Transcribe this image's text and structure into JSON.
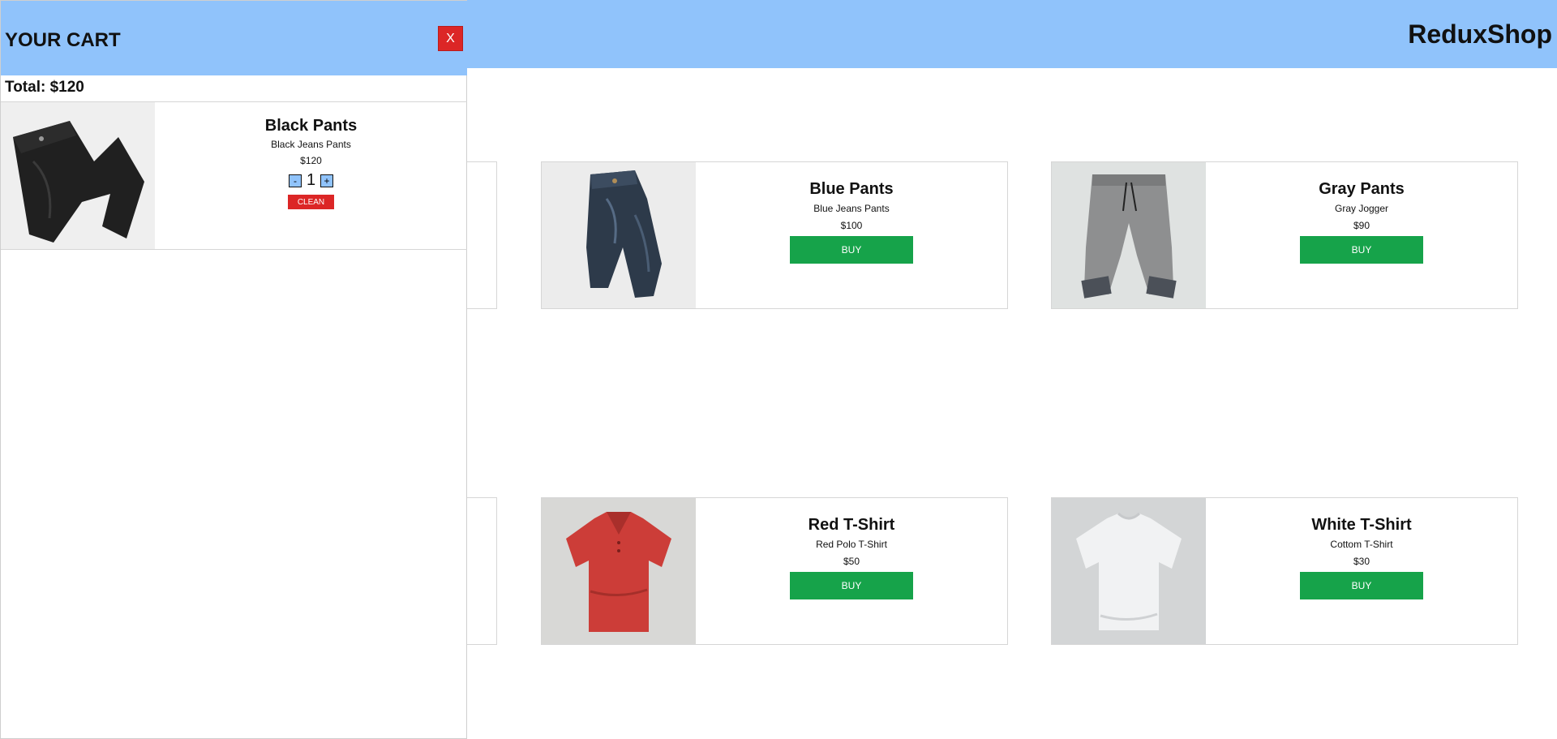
{
  "header": {
    "brand": "ReduxShop"
  },
  "products": [
    {
      "name": "Blue Pants",
      "desc": "Blue Jeans Pants",
      "price": "$100",
      "buy": "BUY",
      "icon": "blue-jeans-icon"
    },
    {
      "name": "Gray Pants",
      "desc": "Gray Jogger",
      "price": "$90",
      "buy": "BUY",
      "icon": "gray-jogger-icon"
    },
    {
      "name": "Red T-Shirt",
      "desc": "Red Polo T-Shirt",
      "price": "$50",
      "buy": "BUY",
      "icon": "red-polo-icon"
    },
    {
      "name": "White T-Shirt",
      "desc": "Cottom T-Shirt",
      "price": "$30",
      "buy": "BUY",
      "icon": "white-tshirt-icon"
    }
  ],
  "cart": {
    "title": "YOUR CART",
    "close": "X",
    "total": "Total: $120",
    "items": [
      {
        "name": "Black Pants",
        "desc": "Black Jeans Pants",
        "price": "$120",
        "qty": "1",
        "minus": "-",
        "plus": "+",
        "clean": "CLEAN",
        "icon": "black-jeans-icon"
      }
    ]
  },
  "colors": {
    "header": "#90c3fb",
    "buy": "#16a34a",
    "danger": "#dc2626"
  }
}
